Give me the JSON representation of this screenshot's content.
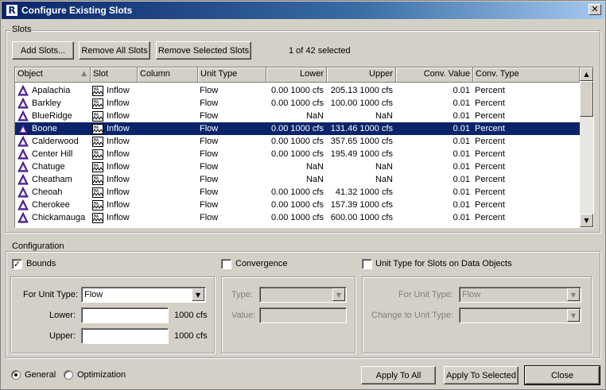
{
  "window": {
    "title": "Configure Existing Slots",
    "close_glyph": "✕"
  },
  "slots_group": {
    "label": "Slots"
  },
  "toolbar": {
    "add_slots": "Add Slots...",
    "remove_all": "Remove All Slots",
    "remove_selected": "Remove Selected Slots",
    "selection_status": "1 of 42 selected"
  },
  "table": {
    "columns": [
      "Object",
      "Slot",
      "Column",
      "Unit Type",
      "Lower",
      "Upper",
      "Conv. Value",
      "Conv. Type"
    ],
    "sort_indicator": "▲",
    "rows": [
      {
        "object": "Apalachia",
        "slot": "Inflow",
        "column": "",
        "unit_type": "Flow",
        "lower": "0.00 1000 cfs",
        "upper": "205.13 1000 cfs",
        "conv_value": "0.01",
        "conv_type": "Percent"
      },
      {
        "object": "Barkley",
        "slot": "Inflow",
        "column": "",
        "unit_type": "Flow",
        "lower": "0.00 1000 cfs",
        "upper": "100.00 1000 cfs",
        "conv_value": "0.01",
        "conv_type": "Percent"
      },
      {
        "object": "BlueRidge",
        "slot": "Inflow",
        "column": "",
        "unit_type": "Flow",
        "lower": "NaN",
        "upper": "NaN",
        "conv_value": "0.01",
        "conv_type": "Percent"
      },
      {
        "object": "Boone",
        "slot": "Inflow",
        "column": "",
        "unit_type": "Flow",
        "lower": "0.00 1000 cfs",
        "upper": "131.46 1000 cfs",
        "conv_value": "0.01",
        "conv_type": "Percent",
        "selected": true
      },
      {
        "object": "Calderwood",
        "slot": "Inflow",
        "column": "",
        "unit_type": "Flow",
        "lower": "0.00 1000 cfs",
        "upper": "357.65 1000 cfs",
        "conv_value": "0.01",
        "conv_type": "Percent"
      },
      {
        "object": "Center Hill",
        "slot": "Inflow",
        "column": "",
        "unit_type": "Flow",
        "lower": "0.00 1000 cfs",
        "upper": "195.49 1000 cfs",
        "conv_value": "0.01",
        "conv_type": "Percent"
      },
      {
        "object": "Chatuge",
        "slot": "Inflow",
        "column": "",
        "unit_type": "Flow",
        "lower": "NaN",
        "upper": "NaN",
        "conv_value": "0.01",
        "conv_type": "Percent"
      },
      {
        "object": "Cheatham",
        "slot": "Inflow",
        "column": "",
        "unit_type": "Flow",
        "lower": "NaN",
        "upper": "NaN",
        "conv_value": "0.01",
        "conv_type": "Percent"
      },
      {
        "object": "Cheoah",
        "slot": "Inflow",
        "column": "",
        "unit_type": "Flow",
        "lower": "0.00 1000 cfs",
        "upper": "41.32 1000 cfs",
        "conv_value": "0.01",
        "conv_type": "Percent"
      },
      {
        "object": "Cherokee",
        "slot": "Inflow",
        "column": "",
        "unit_type": "Flow",
        "lower": "0.00 1000 cfs",
        "upper": "157.39 1000 cfs",
        "conv_value": "0.01",
        "conv_type": "Percent"
      },
      {
        "object": "Chickamauga",
        "slot": "Inflow",
        "column": "",
        "unit_type": "Flow",
        "lower": "0.00 1000 cfs",
        "upper": "600.00 1000 cfs",
        "conv_value": "0.01",
        "conv_type": "Percent"
      }
    ]
  },
  "configuration": {
    "label": "Configuration",
    "bounds": {
      "label": "Bounds",
      "checked": true,
      "unit_type_label": "For Unit Type:",
      "unit_type_value": "Flow",
      "lower_label": "Lower:",
      "lower_unit": "1000 cfs",
      "upper_label": "Upper:",
      "upper_unit": "1000 cfs"
    },
    "convergence": {
      "label": "Convergence",
      "checked": false,
      "type_label": "Type:",
      "value_label": "Value:"
    },
    "unit_type_slots": {
      "label": "Unit Type for Slots on Data Objects",
      "checked": false,
      "for_unit_type_label": "For Unit Type:",
      "for_unit_type_value": "Flow",
      "change_to_label": "Change to Unit Type:"
    }
  },
  "footer": {
    "radio_general": "General",
    "radio_optimization": "Optimization",
    "selected_mode": "General",
    "apply_all": "Apply To All",
    "apply_selected": "Apply To Selected",
    "close": "Close"
  },
  "colors": {
    "selection": "#0a246a",
    "titlebar": "#0a246a",
    "object_icon": "#6a3cc4",
    "dialog_bg": "#d4d0c8"
  },
  "icons": {
    "object": "reservoir-triangle-icon",
    "slot": "time-series-slot-icon",
    "dropdown": "chevron-down-icon",
    "check": "checkmark-icon"
  }
}
